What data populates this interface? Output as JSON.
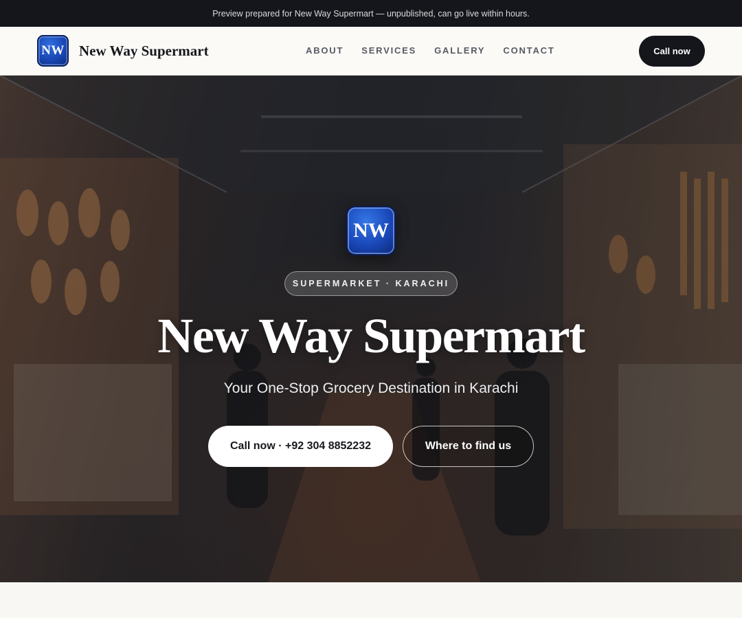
{
  "announcement": "Preview prepared for New Way Supermart — unpublished, can go live within hours.",
  "header": {
    "logo_text": "NW",
    "brand_name": "New Way Supermart",
    "nav": [
      "ABOUT",
      "SERVICES",
      "GALLERY",
      "CONTACT"
    ],
    "cta_label": "Call now"
  },
  "hero": {
    "logo_text": "NW",
    "badge": "SUPERMARKET · KARACHI",
    "title": "New Way Supermart",
    "subtitle": "Your One-Stop Grocery Destination in Karachi",
    "primary_button": "Call now · +92 304 8852232",
    "secondary_button": "Where to find us",
    "background_image": "market-interior-photo"
  },
  "colors": {
    "dark": "#14161b",
    "logo_blue": "#1a48b8",
    "page_bg": "#f8f7f4"
  }
}
